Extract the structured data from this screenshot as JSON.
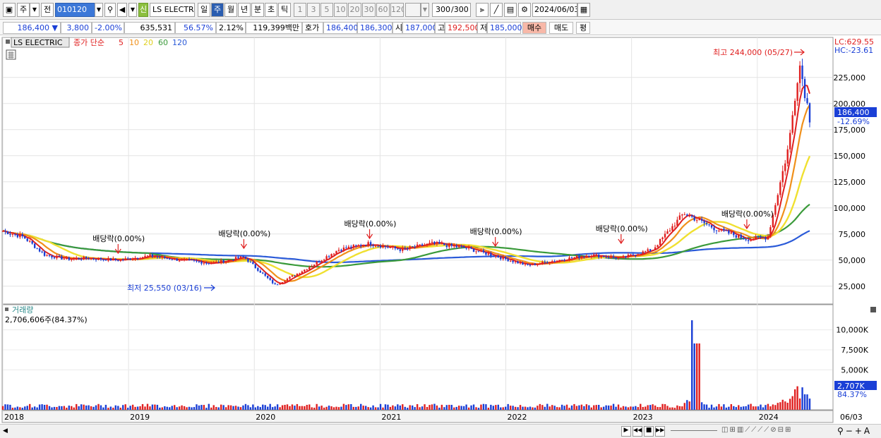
{
  "toolbar": {
    "market": "주",
    "prefix": "전",
    "code": "010120",
    "new_badge": "신",
    "stock_name": "LS ELECTRI",
    "periods": [
      "일",
      "주",
      "월",
      "년",
      "분",
      "초",
      "틱"
    ],
    "intervals": [
      "1",
      "3",
      "5",
      "10",
      "20",
      "30",
      "60",
      "120"
    ],
    "count": "300",
    "count_total": "/300",
    "date": "2024/06/03"
  },
  "quote": {
    "price": "186,400",
    "change": "3,800",
    "change_pct": "-2.00%",
    "volume": "635,531",
    "vol_ratio": "56.57%",
    "turnover": "2.12%",
    "amount": "119,399백만",
    "ask_label": "호가",
    "ask": "186,400",
    "bid": "186,300",
    "open_label": "시",
    "open": "187,000",
    "high_label": "고",
    "high": "192,500",
    "low_label": "저",
    "low": "185,000",
    "buy_label": "매수",
    "sell_label": "매도",
    "avg_label": "평"
  },
  "chart_data": {
    "type": "candlestick",
    "title": "LS ELECTRIC",
    "indicator_label": "종가 단순",
    "ma_periods": [
      "5",
      "10",
      "20",
      "60",
      "120"
    ],
    "colors": {
      "up": "#e02020",
      "down": "#1a3fd6",
      "ma5": "#e02020",
      "ma10": "#f0901a",
      "ma20": "#f0e030",
      "ma60": "#3a9a3a",
      "ma120": "#2a5ad8"
    },
    "x_labels": [
      "2018",
      "2019",
      "2020",
      "2021",
      "2022",
      "2023",
      "2024",
      "06/03"
    ],
    "y_ticks": [
      25000,
      50000,
      75000,
      100000,
      125000,
      150000,
      175000,
      200000,
      225000
    ],
    "y_tick_labels": [
      "25,000",
      "50,000",
      "75,000",
      "100,000",
      "125,000",
      "150,000",
      "175,000",
      "200,000",
      "225,000"
    ],
    "ylim": [
      10000,
      260000
    ],
    "lc_label": "LC:629.55",
    "hc_label": "HC:-23.61",
    "last_price": "186,400",
    "last_pct": "-12.69%",
    "high_annotation": "최고 244,000 (05/27)",
    "low_annotation": "최저 25,550 (03/16)",
    "dividend_label": "배당락(0.00%)",
    "dividend_dates": [
      "2018-12",
      "2019-12",
      "2020-12",
      "2021-12",
      "2022-12",
      "2023-12"
    ],
    "weekly_close": [
      [
        "2018-01",
        78000
      ],
      [
        "2018-03",
        72000
      ],
      [
        "2018-05",
        55000
      ],
      [
        "2018-07",
        51000
      ],
      [
        "2018-09",
        52000
      ],
      [
        "2018-12",
        50000
      ],
      [
        "2019-03",
        54000
      ],
      [
        "2019-06",
        50000
      ],
      [
        "2019-09",
        47000
      ],
      [
        "2019-12",
        53000
      ],
      [
        "2020-03",
        26000
      ],
      [
        "2020-06",
        42000
      ],
      [
        "2020-09",
        60000
      ],
      [
        "2020-12",
        66000
      ],
      [
        "2021-03",
        60000
      ],
      [
        "2021-06",
        66000
      ],
      [
        "2021-09",
        62000
      ],
      [
        "2021-12",
        54000
      ],
      [
        "2022-03",
        45000
      ],
      [
        "2022-06",
        50000
      ],
      [
        "2022-09",
        55000
      ],
      [
        "2022-12",
        52000
      ],
      [
        "2023-03",
        60000
      ],
      [
        "2023-06",
        95000
      ],
      [
        "2023-09",
        80000
      ],
      [
        "2023-12",
        70000
      ],
      [
        "2024-02",
        72000
      ],
      [
        "2024-04",
        160000
      ],
      [
        "2024-05",
        240000
      ],
      [
        "2024-06",
        186400
      ]
    ]
  },
  "volume": {
    "title": "거래량",
    "current": "2,706,606주(84.37%)",
    "ticks": [
      "10,000K",
      "7,500K",
      "5,000K"
    ],
    "last_label": "2,707K",
    "last_pct": "84.37%"
  }
}
